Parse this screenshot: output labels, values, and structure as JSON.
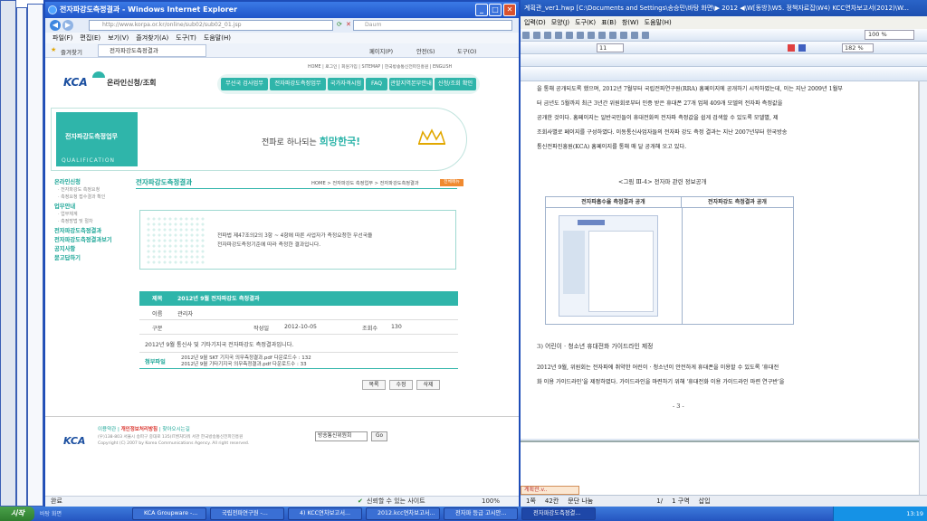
{
  "hwp": {
    "title": "계획관_ver1.hwp [C:\\Documents and Settings\\송승민\\바탕 화면\\▶ 2012 ◀\\W[동방]\\W5. 정책자료집\\W4) KCC연차보고서(2012)\\W...",
    "menu": [
      "입력(D)",
      "모양(J)",
      "도구(K)",
      "표(B)",
      "창(W)",
      "도움말(H)"
    ],
    "zoom1": "100 %",
    "zoom2": "182 %",
    "font_size": "11",
    "paragraphs": [
      "을 통해 공개되도록 했으며, 2012년 7월부터 국립전파연구원(RRA) 홈페이지에 공개하기 시작하였는데, 이는 지난 2009년 1월부",
      "터 금년도 5월까지 최근 3년간 위원회로부터 인증 받은 휴대폰 27개 업체 409개 모델의 전자파 측정값을",
      "공개한 것이다. 홈페이지는 일반국민들이 휴대전화의 전자파 측정값을 쉽게 검색할 수 있도록 모델별, 제",
      "조회사별로 페이지를 구성하였다. 이동통신사업자들의 전자파 강도 측정 결과는 지난 2007년부터 한국방송",
      "통신전파진흥원(KCA) 홈페이지를 통해 매 달 공개해 오고 있다."
    ],
    "figure_caption": "<그림 Ⅲ-4> 전자파 관련 정보공개",
    "figure_col1": "전자파흡수율 측정결과 공개",
    "figure_col2": "전자파강도 측정결과 공개",
    "section_title": "3) 어린이 · 청소년 휴대전화 가이드라인 제정",
    "section_para1": "2012년 9월, 위원회는 전자파에 취약한 어린이 · 청소년이 안전하게 휴대폰을 이용할 수 있도록 '휴대전",
    "section_para2": "화 이용 가이드라인'을 제정하였다. 가이드라인을 마련하기 위해 '휴대전화 이용 가이드라인 마련 연구반'을",
    "page_number": "- 3 -",
    "bottom_tab": "계획관.v..",
    "status": [
      "1쪽",
      "42칸",
      "문단 나눔",
      "1/",
      "1 구역",
      "삽입"
    ]
  },
  "ie": {
    "title": "전자파강도측정결과 - Windows Internet Explorer",
    "url": "http://www.korpa.or.kr/online/sub02/sub02_01.jsp",
    "search_placeholder": "Daum",
    "menu": [
      "파일(F)",
      "편집(E)",
      "보기(V)",
      "즐겨찾기(A)",
      "도구(T)",
      "도움말(H)"
    ],
    "favorites": "즐겨찾기",
    "tab": "전자파강도측정결과",
    "toolbar_right": [
      "페이지(P)",
      "안전(S)",
      "도구(O)"
    ],
    "status_left": "완료",
    "status_zone": "신뢰할 수 있는 사이트",
    "status_zoom": "100%"
  },
  "site": {
    "top_links": "HOME | 로그인 | 회원가입 | SITEMAP | 한국방송통신전파진흥원 | ENGLISH",
    "logo_kca": "KCA",
    "logo_text": "온라인신청/조회",
    "nav": [
      "무선국 검사업무",
      "전자파강도측정업무",
      "국가자격시험",
      "FAQ",
      "관할지역본부안내",
      "신청/조회 확인"
    ],
    "banner_label": "전자파강도측정업무",
    "banner_sub": "QUALIFICATION",
    "slogan_a": "전파로 하나되는",
    "slogan_b": "희망한국!",
    "sidebar": [
      {
        "label": "온라인신청",
        "bold": true
      },
      {
        "label": "· 전자파강도 측정요청",
        "bold": false
      },
      {
        "label": "· 측정요청 접수결과 확인",
        "bold": false
      },
      {
        "label": "업무안내",
        "bold": true
      },
      {
        "label": "· 업무체계",
        "bold": false
      },
      {
        "label": "· 측정방법 및 절차",
        "bold": false
      },
      {
        "label": "전자파강도측정결과",
        "bold": true
      },
      {
        "label": "전자파강도측정결과보기",
        "bold": true
      },
      {
        "label": "공지사항",
        "bold": true
      },
      {
        "label": "묻고답하기",
        "bold": true
      }
    ],
    "page_heading": "전자파강도측정결과",
    "breadcrumb": "HOME > 전자파강도 측정업무 > 전자파강도측정결과",
    "breadcrumb_tag": "전체메뉴",
    "info_text_1": "전파법 제47조의2의 3항 ~ 4항에 따른 사업자가 측정요청한 무선국을",
    "info_text_2": "전자파강도측정기준에 따라 측정한 결과입니다.",
    "subject_label": "제목",
    "subject_value": "2012년 9월 전자파강도 측정결과",
    "name_label": "이름",
    "name_value": "관리자",
    "type_label": "구분",
    "date_label": "작성일",
    "date_value": "2012-10-05",
    "views_label": "조회수",
    "views_value": "130",
    "body_text": "2012년 9월 통신사 및 기타기지국 전자파강도 측정결과입니다.",
    "attach_label": "첨부파일",
    "attach_1": "2012년 9월 SKT 기지국 의무측정결과.pdf  다운로드수 : 132",
    "attach_2": "2012년 9월 기타기지국 의무측정결과.pdf  다운로드수 : 33",
    "btn_list": "목록",
    "btn_edit": "수정",
    "btn_delete": "삭제",
    "footer_links_a": "이용약관 | ",
    "footer_links_b": "개인정보처리방침",
    "footer_links_c": " | 찾아오시는길",
    "footer_addr": "(우)138-803 서울시 송파구 중대로 135(IT벤처타워 서관 한국방송통신전파진흥원",
    "footer_copy": "Copyright (C) 2007 by Korea Communications Agency. All right reserved.",
    "footer_select": "방송통신위원회",
    "footer_go": "Go"
  },
  "taskbar": {
    "start": "시작",
    "quicklaunch": "바탕 화면",
    "tasks": [
      "KCA Groupware -...",
      "국립전파연구원 -...",
      "4) KCC연차보고서...",
      "2012.kcc연차보고서...",
      "전자파 등급 고시안...",
      "전자파강도측정결..."
    ],
    "clock": "13:19"
  }
}
